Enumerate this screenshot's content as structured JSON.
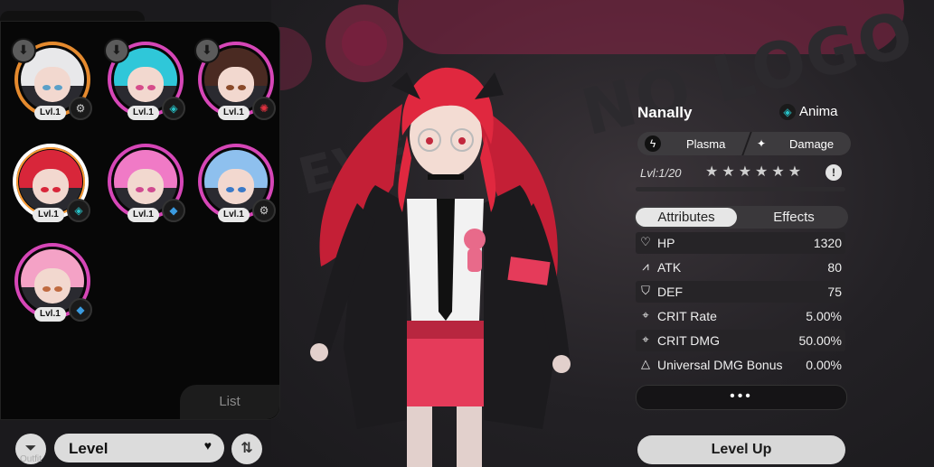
{
  "roster": {
    "characters": [
      {
        "level": "Lvl.1",
        "element": "gear",
        "ring": "#e58a2e",
        "hair": "#e8e8ea",
        "eye": "#5aa0c8",
        "selected": false,
        "downloadable": true
      },
      {
        "level": "Lvl.1",
        "element": "anima",
        "ring": "#d646b7",
        "hair": "#2fc7d9",
        "eye": "#d64c8a",
        "selected": false,
        "downloadable": true
      },
      {
        "level": "Lvl.1",
        "element": "incantation",
        "ring": "#d646b7",
        "hair": "#4a2a22",
        "eye": "#8a4a2a",
        "selected": false,
        "downloadable": true
      },
      {
        "level": "Lvl.1",
        "element": "anima",
        "ring": "#ffffff",
        "hair": "#d8263a",
        "eye": "#d8263a",
        "selected": true,
        "downloadable": false
      },
      {
        "level": "Lvl.1",
        "element": "cosmos",
        "ring": "#d646b7",
        "hair": "#f07ac6",
        "eye": "#d04a90",
        "selected": false,
        "downloadable": false
      },
      {
        "level": "Lvl.1",
        "element": "gear",
        "ring": "#d646b7",
        "hair": "#8ec0ee",
        "eye": "#3a7ac8",
        "selected": false,
        "downloadable": false
      },
      {
        "level": "Lvl.1",
        "element": "cosmos",
        "ring": "#d646b7",
        "hair": "#f4a2c6",
        "eye": "#c06a40",
        "selected": false,
        "downloadable": false
      }
    ],
    "list_label": "List"
  },
  "controls": {
    "sort_value": "Level",
    "outfit_label": "Outfit"
  },
  "character": {
    "name": "Nanally",
    "element": "Anima",
    "attack_type": "Plasma",
    "role": "Damage",
    "level_text": "Lvl:1",
    "level_max": "/20",
    "stars": "★★★★★★",
    "xp_progress": 0.0
  },
  "tabs": {
    "active": "Attributes",
    "inactive": "Effects"
  },
  "attributes": [
    {
      "icon": "♡",
      "name": "HP",
      "value": "1320"
    },
    {
      "icon": "⩘",
      "name": "ATK",
      "value": "80"
    },
    {
      "icon": "⛉",
      "name": "DEF",
      "value": "75"
    },
    {
      "icon": "⌖",
      "name": "CRIT Rate",
      "value": "5.00%"
    },
    {
      "icon": "⌖",
      "name": "CRIT DMG",
      "value": "50.00%"
    },
    {
      "icon": "△",
      "name": "Universal DMG Bonus",
      "value": "0.00%"
    }
  ],
  "buttons": {
    "more": "•••",
    "level_up": "Level Up"
  },
  "colors": {
    "accent": "#d646b7",
    "background": "#1b1a1d",
    "hair": "#e0283f",
    "jacket": "#1c1b1e"
  }
}
